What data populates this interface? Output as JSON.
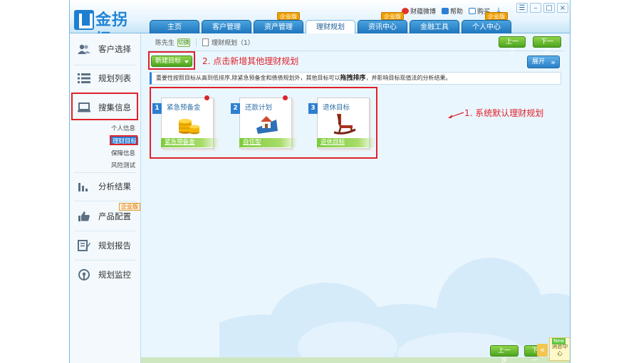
{
  "app": {
    "logo_text": "金拐棍"
  },
  "top_links": [
    {
      "label": "财蕴微博",
      "icon": "weibo-icon",
      "color": "#e2332b"
    },
    {
      "label": "帮助",
      "icon": "help-icon",
      "color": "#2d7fd1"
    },
    {
      "label": "购买",
      "icon": "cart-icon",
      "color": "#2d7fd1"
    }
  ],
  "tabs": [
    {
      "label": "主页",
      "badge": ""
    },
    {
      "label": "客户管理",
      "badge": ""
    },
    {
      "label": "资产管理",
      "badge": "企业版"
    },
    {
      "label": "理财规划",
      "badge": "",
      "active": true
    },
    {
      "label": "资讯中心",
      "badge": "企业版"
    },
    {
      "label": "金融工具",
      "badge": ""
    },
    {
      "label": "个人中心",
      "badge": "企业版"
    }
  ],
  "sidebar": {
    "items": [
      {
        "label": "客户选择",
        "icon": "users-icon"
      },
      {
        "label": "规划列表",
        "icon": "list-icon"
      },
      {
        "label": "搜集信息",
        "icon": "laptop-icon"
      },
      {
        "label": "分析结果",
        "icon": "bar-chart-icon"
      },
      {
        "label": "产品配置",
        "icon": "thumbs-up-icon",
        "badge": "企业版"
      },
      {
        "label": "规划报告",
        "icon": "report-edit-icon"
      },
      {
        "label": "规划监控",
        "icon": "monitor-icon"
      }
    ],
    "sub_items": [
      "个人信息",
      "理财目标",
      "保障信息",
      "风险测试"
    ]
  },
  "breadcrumb": {
    "client": "陈先生",
    "switch_label": "切换",
    "plan": "理财规划（1）"
  },
  "buttons": {
    "prev": "上一步",
    "next": "下一步",
    "new_goal": "新建目标",
    "expand": "展开"
  },
  "notes": {
    "step2": "2. 点击新增其他理财规划",
    "step1": "1. 系统默认理财规划"
  },
  "info_bar": {
    "text_before": "重要性按照目标从高到低排序,除紧急预备金和债债规划外，其他目标可以",
    "bold": "拖拽排序",
    "text_after": "，并影响目标现值法的分析结果。"
  },
  "goals": [
    {
      "num": "1",
      "title": "紧急预备金",
      "footer": "紧急预备金",
      "icon": "coins-icon"
    },
    {
      "num": "2",
      "title": "还款计划",
      "footer": "自住型",
      "icon": "house-icon"
    },
    {
      "num": "3",
      "title": "退休目标",
      "footer": "退休目标",
      "icon": "rocking-chair-icon"
    }
  ],
  "message_center": {
    "badge": "New",
    "label": "消息中心"
  },
  "colors": {
    "accent": "#2d7fd1",
    "annotation_red": "#e0202a",
    "button_green": "#4da41e"
  }
}
